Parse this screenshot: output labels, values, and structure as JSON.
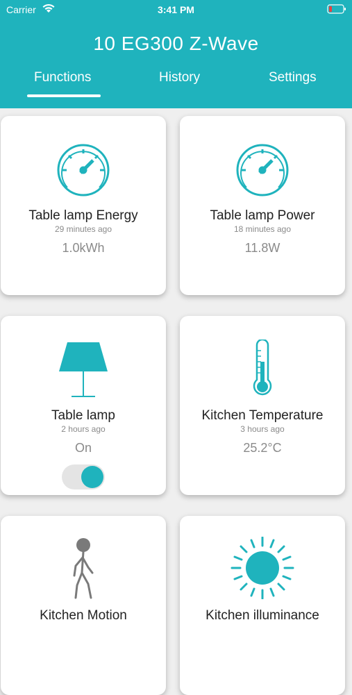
{
  "status_bar": {
    "carrier": "Carrier",
    "time": "3:41 PM"
  },
  "header": {
    "title": "10 EG300 Z-Wave",
    "tabs": [
      {
        "label": "Functions",
        "active": true
      },
      {
        "label": "History",
        "active": false
      },
      {
        "label": "Settings",
        "active": false
      }
    ]
  },
  "cards": [
    {
      "name": "Table lamp Energy",
      "time": "29 minutes ago",
      "value": "1.0kWh",
      "icon": "gauge-icon"
    },
    {
      "name": "Table lamp Power",
      "time": "18 minutes ago",
      "value": "11.8W",
      "icon": "gauge-icon"
    },
    {
      "name": "Table lamp",
      "time": "2 hours ago",
      "value": "On",
      "icon": "lamp-icon",
      "toggle_on": true
    },
    {
      "name": "Kitchen Temperature",
      "time": "3 hours ago",
      "value": "25.2°C",
      "icon": "thermometer-icon"
    },
    {
      "name": "Kitchen Motion",
      "icon": "walking-person-icon"
    },
    {
      "name": "Kitchen illuminance",
      "icon": "sun-icon"
    }
  ],
  "colors": {
    "accent": "#1fb3bd",
    "background": "#efefef"
  }
}
